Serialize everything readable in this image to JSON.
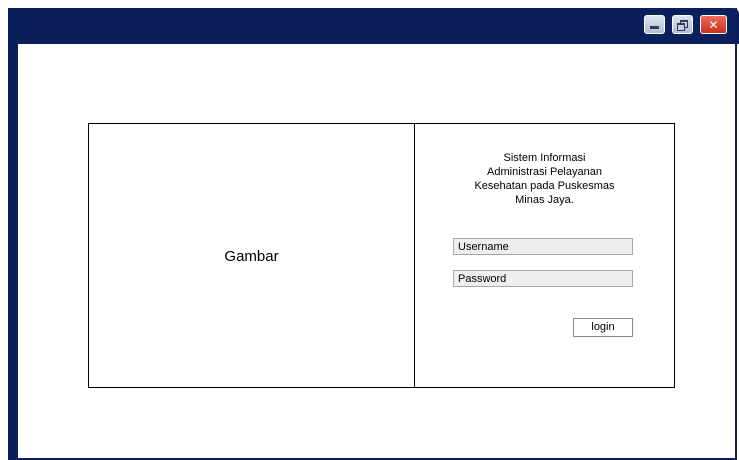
{
  "window": {
    "controls": {
      "minimize_icon": "minimize-icon",
      "maximize_icon": "restore-icon",
      "close_icon": "close-icon",
      "close_glyph": "✕"
    },
    "colors": {
      "titlebar": "#0a1f5c",
      "close_button": "#c8301f"
    }
  },
  "login": {
    "image_placeholder": "Gambar",
    "app_title": "Sistem Informasi\nAdministrasi Pelayanan\nKesehatan pada Puskesmas\nMinas Jaya.",
    "username_value": "Username",
    "password_value": "Password",
    "login_label": "login"
  }
}
